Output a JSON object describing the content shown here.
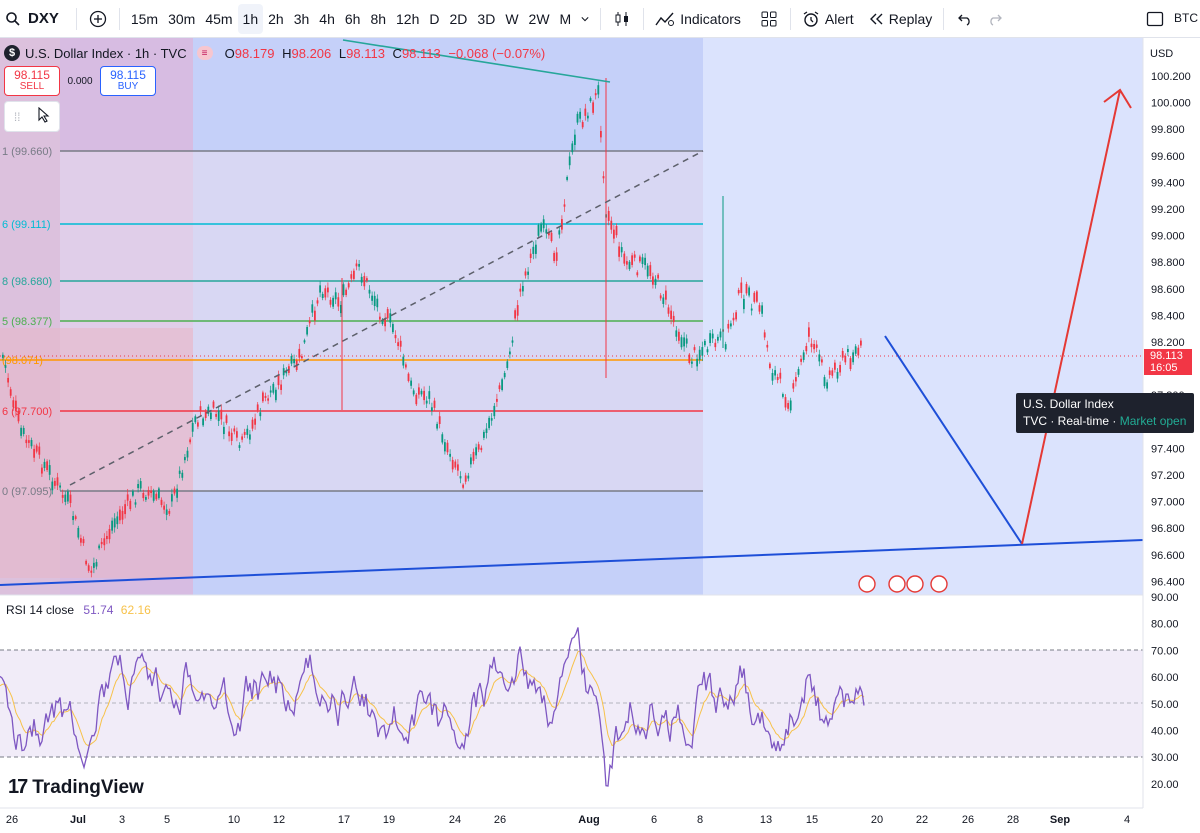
{
  "toolbar": {
    "symbol": "DXY",
    "intervals": [
      "15m",
      "30m",
      "45m",
      "1h",
      "2h",
      "3h",
      "4h",
      "6h",
      "8h",
      "12h",
      "D",
      "2D",
      "3D",
      "W",
      "2W",
      "M"
    ],
    "active_interval": "1h",
    "indicators_label": "Indicators",
    "alert_label": "Alert",
    "replay_label": "Replay",
    "right_label": "BTC"
  },
  "legend": {
    "symbol_badge": "$",
    "title": "U.S. Dollar Index · 1h · TVC",
    "o_key": "O",
    "o_val": "98.179",
    "h_key": "H",
    "h_val": "98.206",
    "l_key": "L",
    "l_val": "98.113",
    "c_key": "C",
    "c_val": "98.113",
    "change": "−0.068 (−0.07%)"
  },
  "trade": {
    "sell_price": "98.115",
    "sell_label": "SELL",
    "spread": "0.000",
    "buy_price": "98.115",
    "buy_label": "BUY"
  },
  "price_axis": {
    "currency": "USD",
    "labels": [
      "100.200",
      "100.000",
      "99.800",
      "99.600",
      "99.400",
      "99.200",
      "99.000",
      "98.800",
      "98.600",
      "98.400",
      "98.200",
      "98.000",
      "97.800",
      "97.600",
      "97.400",
      "97.200",
      "97.000",
      "96.800",
      "96.600",
      "96.400"
    ],
    "current_price": "98.113",
    "countdown": "16:05"
  },
  "fib_levels": [
    {
      "label": "1 (99.660)",
      "color": "#787b86"
    },
    {
      "label": "6 (99.111)",
      "color": "#00bcd4"
    },
    {
      "label": "8 (98.680)",
      "color": "#26a69a"
    },
    {
      "label": "5 (98.377)",
      "color": "#4caf50"
    },
    {
      "label": "(98.071)",
      "color": "#ff9800"
    },
    {
      "label": "6 (97.700)",
      "color": "#f23645"
    },
    {
      "label": "0 (97.095)",
      "color": "#787b86"
    }
  ],
  "tooltip": {
    "title": "U.S. Dollar Index",
    "source": "TVC",
    "mode": "Real-time",
    "status": "Market open"
  },
  "rsi": {
    "label": "RSI 14 close",
    "value": "51.74",
    "ma_value": "62.16",
    "axis_labels": [
      "90.00",
      "80.00",
      "70.00",
      "60.00",
      "50.00",
      "40.00",
      "30.00",
      "20.00"
    ],
    "colors": {
      "line": "#7e57c2",
      "ma": "#f7c24a"
    }
  },
  "time_axis": {
    "labels": [
      "26",
      "Jul",
      "3",
      "5",
      "10",
      "12",
      "17",
      "19",
      "24",
      "26",
      "Aug",
      "6",
      "8",
      "13",
      "15",
      "20",
      "22",
      "26",
      "28",
      "Sep",
      "4"
    ]
  },
  "brand": {
    "logo_text": "TradingView"
  },
  "colors": {
    "down": "#f23645",
    "up": "#089981",
    "accent": "#2962ff",
    "channel_line": "#1e4fd8",
    "projection_up": "#e53935"
  }
}
